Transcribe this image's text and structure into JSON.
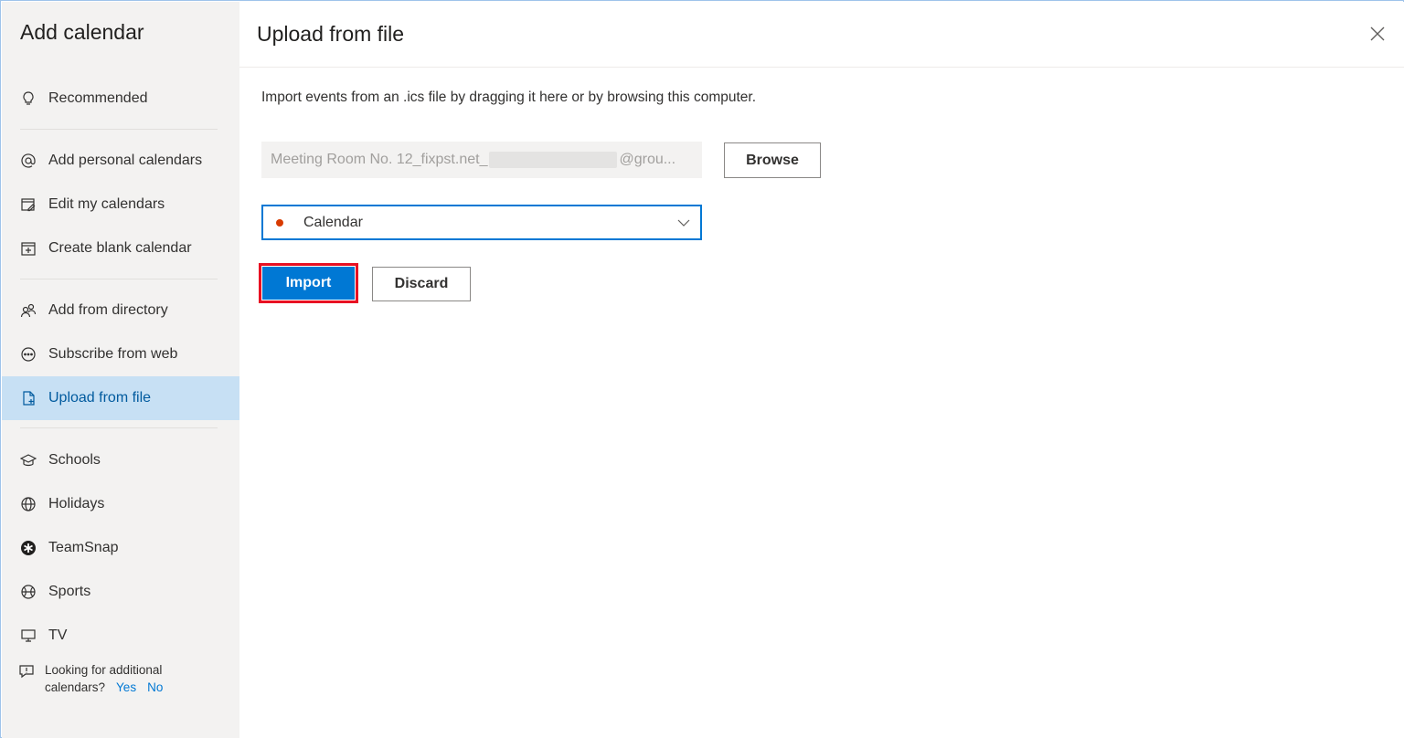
{
  "sidebar": {
    "title": "Add calendar",
    "items": [
      {
        "label": "Recommended",
        "icon": "lightbulb-icon"
      },
      {
        "label": "Add personal calendars",
        "icon": "at-sign-icon"
      },
      {
        "label": "Edit my calendars",
        "icon": "edit-calendar-icon"
      },
      {
        "label": "Create blank calendar",
        "icon": "calendar-add-icon"
      },
      {
        "label": "Add from directory",
        "icon": "people-icon"
      },
      {
        "label": "Subscribe from web",
        "icon": "web-subscribe-icon"
      },
      {
        "label": "Upload from file",
        "icon": "file-upload-icon",
        "selected": true
      },
      {
        "label": "Schools",
        "icon": "graduation-cap-icon"
      },
      {
        "label": "Holidays",
        "icon": "globe-icon"
      },
      {
        "label": "TeamSnap",
        "icon": "teamsnap-icon"
      },
      {
        "label": "Sports",
        "icon": "sports-ball-icon"
      },
      {
        "label": "TV",
        "icon": "tv-icon"
      }
    ],
    "feedback": {
      "line1": "Looking for additional",
      "line2": "calendars?",
      "yes": "Yes",
      "no": "No"
    }
  },
  "main": {
    "title": "Upload from file",
    "description": "Import events from an .ics file by dragging it here or by browsing this computer.",
    "file_field": {
      "value_start": "Meeting Room No. 12_fixpst.net_",
      "value_end": "@grou..."
    },
    "browse_label": "Browse",
    "calendar_select": {
      "selected": "Calendar",
      "dot_color": "#d83b01"
    },
    "import_label": "Import",
    "discard_label": "Discard"
  },
  "colors": {
    "accent": "#0078d4",
    "selected_bg": "#c7e0f4",
    "highlight_border": "#e81123"
  }
}
